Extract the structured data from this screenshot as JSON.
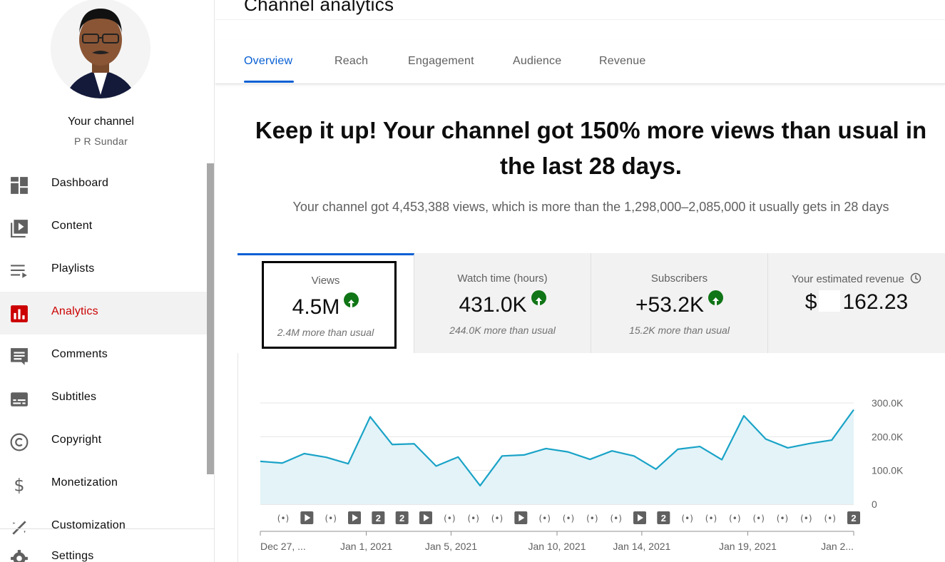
{
  "sidebar": {
    "channel_title": "Your channel",
    "channel_name": "P R Sundar",
    "items": [
      {
        "label": "Dashboard",
        "icon": "dashboard-icon"
      },
      {
        "label": "Content",
        "icon": "content-icon"
      },
      {
        "label": "Playlists",
        "icon": "playlists-icon"
      },
      {
        "label": "Analytics",
        "icon": "analytics-icon",
        "active": true
      },
      {
        "label": "Comments",
        "icon": "comments-icon"
      },
      {
        "label": "Subtitles",
        "icon": "subtitles-icon"
      },
      {
        "label": "Copyright",
        "icon": "copyright-icon"
      },
      {
        "label": "Monetization",
        "icon": "monetization-icon"
      },
      {
        "label": "Customization",
        "icon": "customization-icon"
      },
      {
        "label": "Settings",
        "icon": "settings-icon"
      }
    ]
  },
  "header": {
    "title": "Channel analytics",
    "tabs": [
      "Overview",
      "Reach",
      "Engagement",
      "Audience",
      "Revenue"
    ],
    "active_tab": "Overview"
  },
  "summary": {
    "headline": "Keep it up! Your channel got 150% more views than usual in the last 28 days.",
    "subline": "Your channel got 4,453,388 views, which is more than the 1,298,000–2,085,000 it usually gets in 28 days"
  },
  "cards": [
    {
      "label": "Views",
      "value": "4.5M",
      "sub": "2.4M more than usual",
      "trend": "up"
    },
    {
      "label": "Watch time (hours)",
      "value": "431.0K",
      "sub": "244.0K more than usual",
      "trend": "up"
    },
    {
      "label": "Subscribers",
      "value": "+53.2K",
      "sub": "15.2K more than usual",
      "trend": "up"
    },
    {
      "label": "Your estimated revenue",
      "value_prefix": "$",
      "value": "162.23",
      "icon": "clock-icon"
    }
  ],
  "colors": {
    "accent": "#065fd4",
    "active_nav": "#cc0000",
    "trend_up": "#107516",
    "line": "#1aa3c7",
    "area": "#e3f3f8"
  },
  "chart_data": {
    "type": "area",
    "x": [
      "Dec 27",
      "Dec 28",
      "Dec 29",
      "Dec 30",
      "Dec 31",
      "Jan 1, 2021",
      "Jan 2",
      "Jan 3",
      "Jan 4",
      "Jan 5, 2021",
      "Jan 6",
      "Jan 7",
      "Jan 8",
      "Jan 9",
      "Jan 10, 2021",
      "Jan 11",
      "Jan 12",
      "Jan 13",
      "Jan 14, 2021",
      "Jan 15",
      "Jan 16",
      "Jan 17",
      "Jan 18",
      "Jan 19, 2021",
      "Jan 20",
      "Jan 21",
      "Jan 22",
      "Jan 23",
      "Jan 24"
    ],
    "series": [
      {
        "values": [
          127,
          122,
          150,
          139,
          120,
          259,
          177,
          179,
          113,
          140,
          55,
          143,
          146,
          165,
          155,
          133,
          158,
          143,
          104,
          163,
          171,
          132,
          262,
          193,
          167,
          180,
          190,
          280
        ]
      }
    ],
    "x_tick_labels": [
      "Dec 27, ...",
      "Jan 1, 2021",
      "Jan 5, 2021",
      "Jan 10, 2021",
      "Jan 14, 2021",
      "Jan 19, 2021",
      "Jan 2..."
    ],
    "y_tick_labels": [
      "300.0K",
      "200.0K",
      "100.0K",
      "0"
    ],
    "ylim": [
      0,
      300
    ],
    "grid": true,
    "markers": [
      "live",
      "video",
      "live",
      "video",
      "badge-2",
      "badge-2",
      "video",
      "live",
      "live",
      "live",
      "video",
      "live",
      "live",
      "live",
      "live",
      "video",
      "badge-2",
      "live",
      "live",
      "live",
      "live",
      "live",
      "live",
      "live",
      "badge-2"
    ],
    "badge_text": "2"
  }
}
